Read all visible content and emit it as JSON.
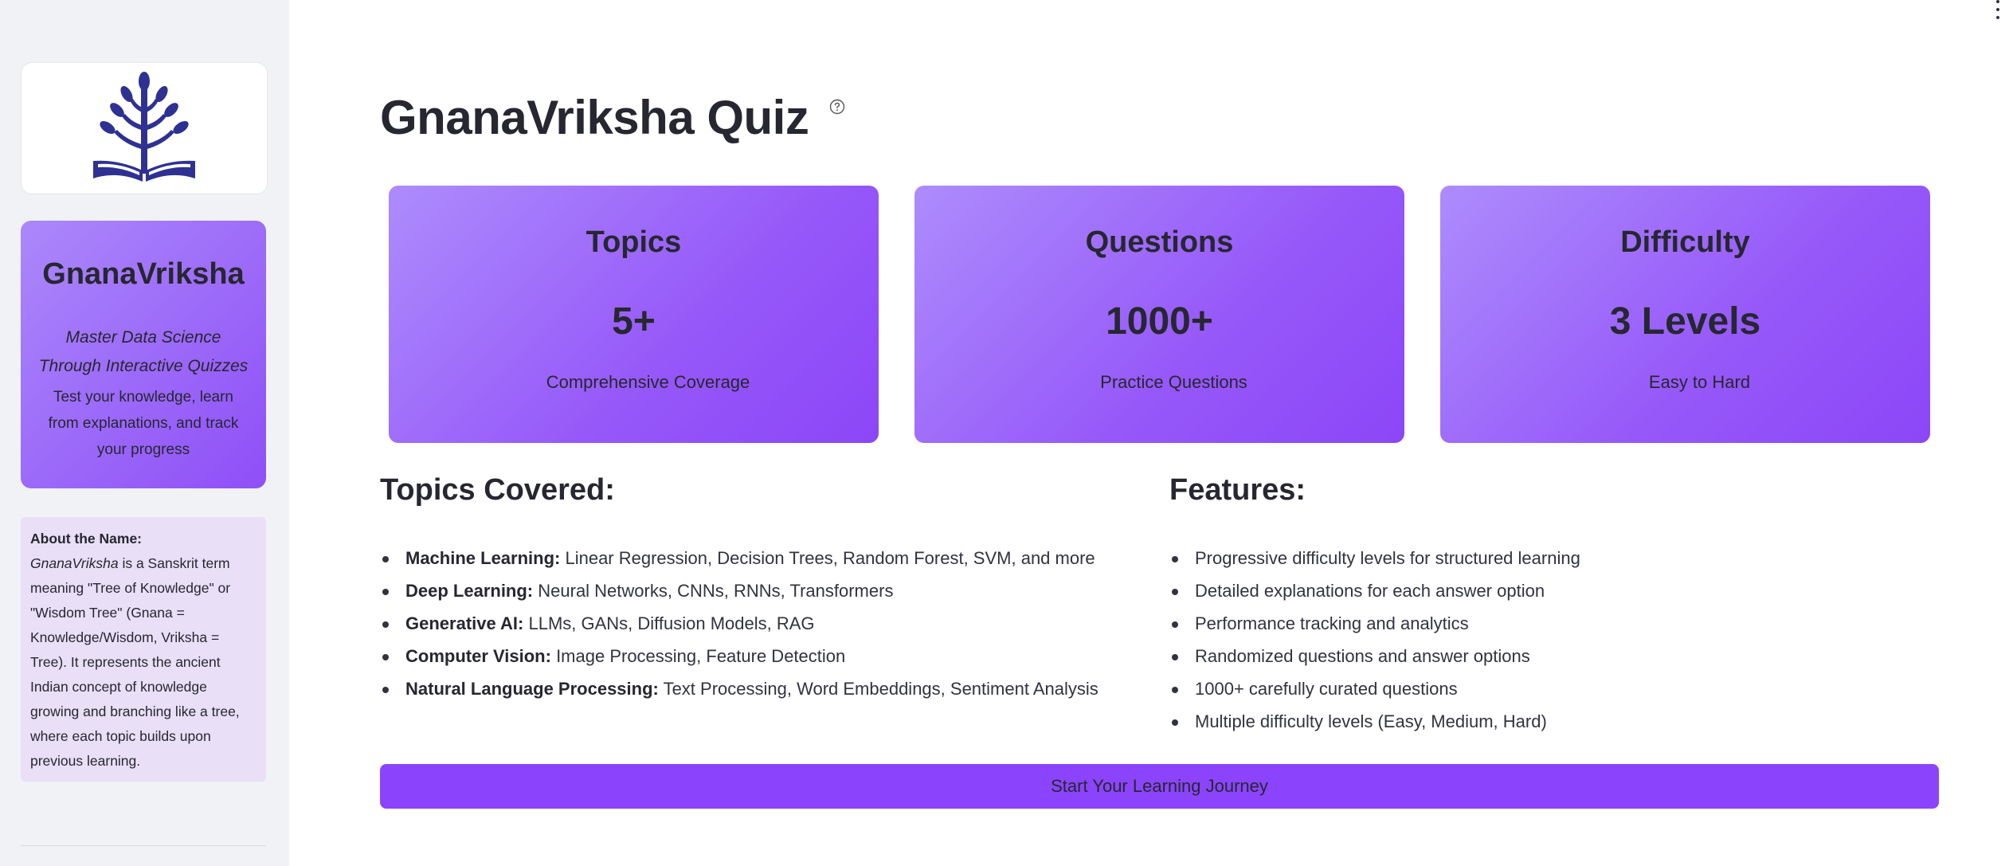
{
  "sidebar": {
    "logo_icon": "tree-of-knowledge-book-icon",
    "brand": {
      "title": "GnanaVriksha",
      "tagline_1": "Master Data Science",
      "tagline_2": "Through Interactive Quizzes",
      "desc_1": "Test your knowledge, learn",
      "desc_2": "from explanations, and track",
      "desc_3": "your progress"
    },
    "about": {
      "title": "About the Name:",
      "lines": [
        {
          "em": "GnanaVriksha",
          "text": " is a Sanskrit term"
        },
        {
          "em": "",
          "text": "meaning \"Tree of Knowledge\" or"
        },
        {
          "em": "",
          "text": "\"Wisdom Tree\" (Gnana ="
        },
        {
          "em": "",
          "text": "Knowledge/Wisdom, Vriksha ="
        },
        {
          "em": "",
          "text": "Tree). It represents the ancient"
        },
        {
          "em": "",
          "text": "Indian concept of knowledge"
        },
        {
          "em": "",
          "text": "growing and branching like a tree,"
        },
        {
          "em": "",
          "text": "where each topic builds upon"
        },
        {
          "em": "",
          "text": "previous learning."
        }
      ]
    }
  },
  "main": {
    "title": "GnanaVriksha Quiz",
    "help_icon": "help-circle-icon",
    "stats": [
      {
        "label": "Topics",
        "value": "5+",
        "sub": "Comprehensive Coverage"
      },
      {
        "label": "Questions",
        "value": "1000+",
        "sub": "Practice Questions"
      },
      {
        "label": "Difficulty",
        "value": "3 Levels",
        "sub": "Easy to Hard"
      }
    ],
    "topics": {
      "heading": "Topics Covered:",
      "items": [
        {
          "bold": "Machine Learning:",
          "text": " Linear Regression, Decision Trees, Random Forest, SVM, and more"
        },
        {
          "bold": "Deep Learning:",
          "text": " Neural Networks, CNNs, RNNs, Transformers"
        },
        {
          "bold": "Generative AI:",
          "text": " LLMs, GANs, Diffusion Models, RAG"
        },
        {
          "bold": "Computer Vision:",
          "text": " Image Processing, Feature Detection"
        },
        {
          "bold": "Natural Language Processing:",
          "text": " Text Processing, Word Embeddings, Sentiment Analysis"
        }
      ]
    },
    "features": {
      "heading": "Features:",
      "items": [
        "Progressive difficulty levels for structured learning",
        "Detailed explanations for each answer option",
        "Performance tracking and analytics",
        "Randomized questions and answer options",
        "1000+ carefully curated questions",
        "Multiple difficulty levels (Easy, Medium, Hard)"
      ]
    },
    "start_button": "Start Your Learning Journey"
  },
  "colors": {
    "accent": "#8b44fc",
    "card_gradient_start": "#ad8cfc",
    "card_gradient_end": "#8c46f7",
    "sidebar_bg": "#f0f2f6",
    "about_bg": "#e9dff7",
    "logo": "#2e3192"
  }
}
